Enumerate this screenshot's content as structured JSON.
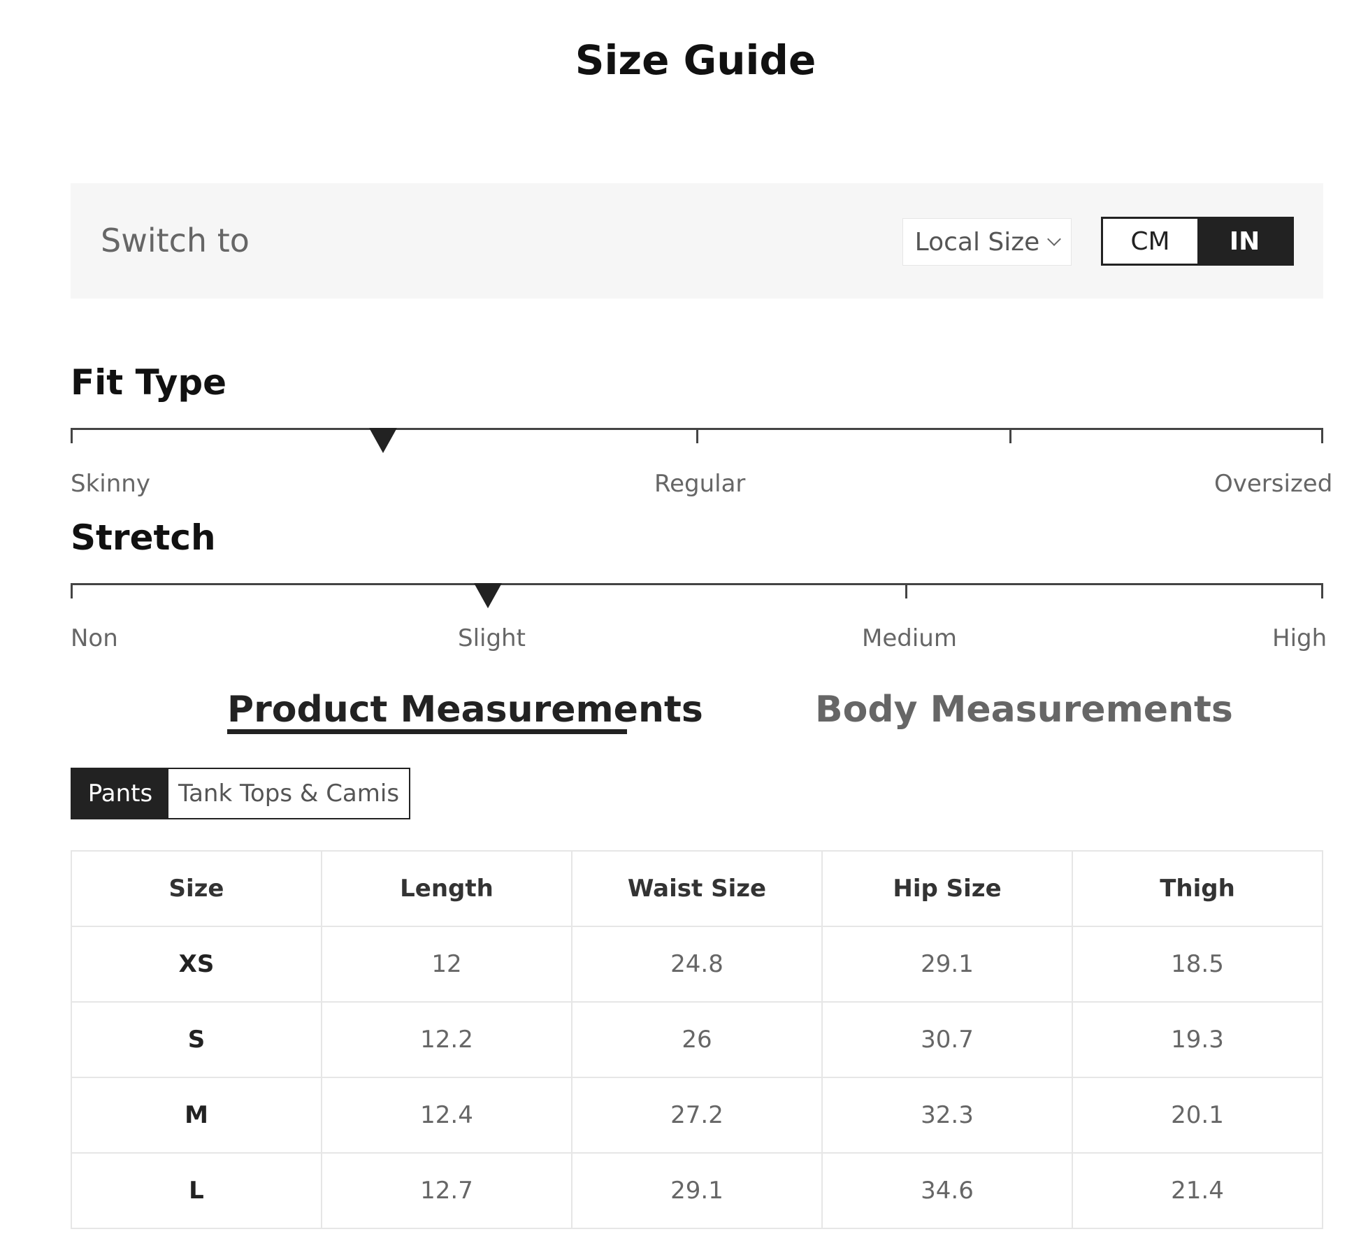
{
  "title": "Size Guide",
  "switch_bar": {
    "label": "Switch to",
    "local_size": "Local Size",
    "units": {
      "cm": "CM",
      "in": "IN",
      "selected": "IN"
    }
  },
  "fit_type": {
    "title": "Fit Type",
    "labels": {
      "skinny": "Skinny",
      "regular": "Regular",
      "oversized": "Oversized"
    },
    "selected_position": 0.25
  },
  "stretch": {
    "title": "Stretch",
    "labels": {
      "non": "Non",
      "slight": "Slight",
      "medium": "Medium",
      "high": "High"
    },
    "selected_position": 0.333
  },
  "measurement_tabs": {
    "product": "Product Measurements",
    "body": "Body Measurements",
    "selected": "Product Measurements"
  },
  "category_tabs": {
    "pants": "Pants",
    "tank_tops": "Tank Tops & Camis",
    "selected": "Pants"
  },
  "table": {
    "headers": [
      "Size",
      "Length",
      "Waist Size",
      "Hip Size",
      "Thigh"
    ],
    "rows": [
      [
        "XS",
        "12",
        "24.8",
        "29.1",
        "18.5"
      ],
      [
        "S",
        "12.2",
        "26",
        "30.7",
        "19.3"
      ],
      [
        "M",
        "12.4",
        "27.2",
        "32.3",
        "20.1"
      ],
      [
        "L",
        "12.7",
        "29.1",
        "34.6",
        "21.4"
      ]
    ]
  },
  "colors": {
    "dark": "#222222",
    "switch_bar_bg": "#f6f6f6",
    "muted_text": "#666666",
    "table_border": "#e6e6e6"
  }
}
